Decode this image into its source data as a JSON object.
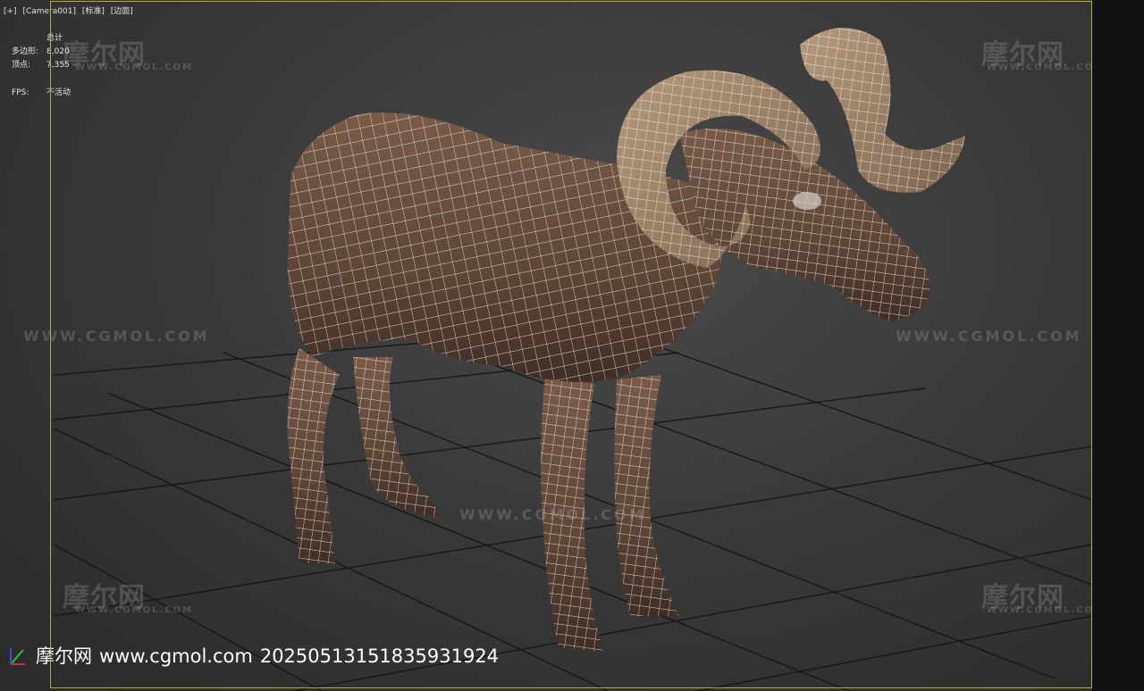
{
  "viewport": {
    "menu": [
      "[+]",
      "[Camera001]",
      "[标准]",
      "[边面]"
    ],
    "stats": {
      "title": "总计",
      "polygons_label": "多边形:",
      "polygons_value": "8,020",
      "vertices_label": "顶点:",
      "vertices_value": "7,355",
      "fps_label": "FPS:",
      "fps_value": "不活动"
    }
  },
  "watermark": {
    "brand": "摩尔网",
    "brand_small": "WWW.CGMOL.COM",
    "url": "WWW.CGMOL.COM"
  },
  "footer": {
    "brand": "摩尔网",
    "url": "www.cgmol.com",
    "id": "20250513151835931924"
  },
  "model": {
    "name": "bighorn-ram",
    "fur_color": "#6b4e3d",
    "horn_color": "#a88a6c",
    "wire_color": "#f2f2f2"
  },
  "colors": {
    "frame": "#b9a83a",
    "grid": "#141414"
  }
}
